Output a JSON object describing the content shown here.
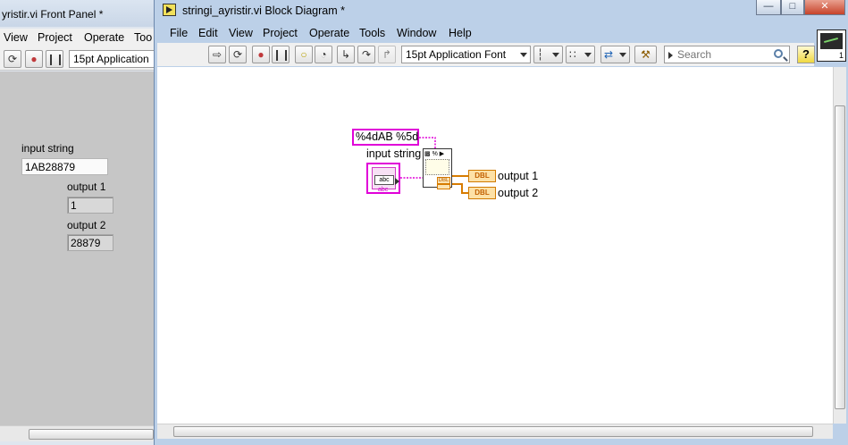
{
  "front_panel": {
    "title": "yristir.vi Front Panel *",
    "menu": [
      "View",
      "Project",
      "Operate",
      "Too"
    ],
    "font_select": "15pt Application",
    "controls": {
      "input_label": "input string",
      "input_value": "1AB28879",
      "output1_label": "output 1",
      "output1_value": "1",
      "output2_label": "output 2",
      "output2_value": "28879"
    }
  },
  "block_diagram": {
    "title": "stringi_ayristir.vi Block Diagram *",
    "menu": [
      "File",
      "Edit",
      "View",
      "Project",
      "Operate",
      "Tools",
      "Window",
      "Help"
    ],
    "font_select": "15pt Application Font",
    "search_placeholder": "Search",
    "help_label": "?",
    "vi_icon_number": "1",
    "diagram": {
      "format_constant": "%4dAB %5d",
      "input_label": "input string",
      "input_terminal_text": "abc",
      "input_terminal_type": "abc",
      "scan_node_header": "%",
      "output1_label": "output 1",
      "output2_label": "output 2",
      "dbl_tag": "DBL"
    }
  },
  "colors": {
    "string_wire": "#e000d8",
    "numeric_wire": "#d77b00",
    "canvas": "#ffffff",
    "window_frame": "#bcd0e8"
  }
}
